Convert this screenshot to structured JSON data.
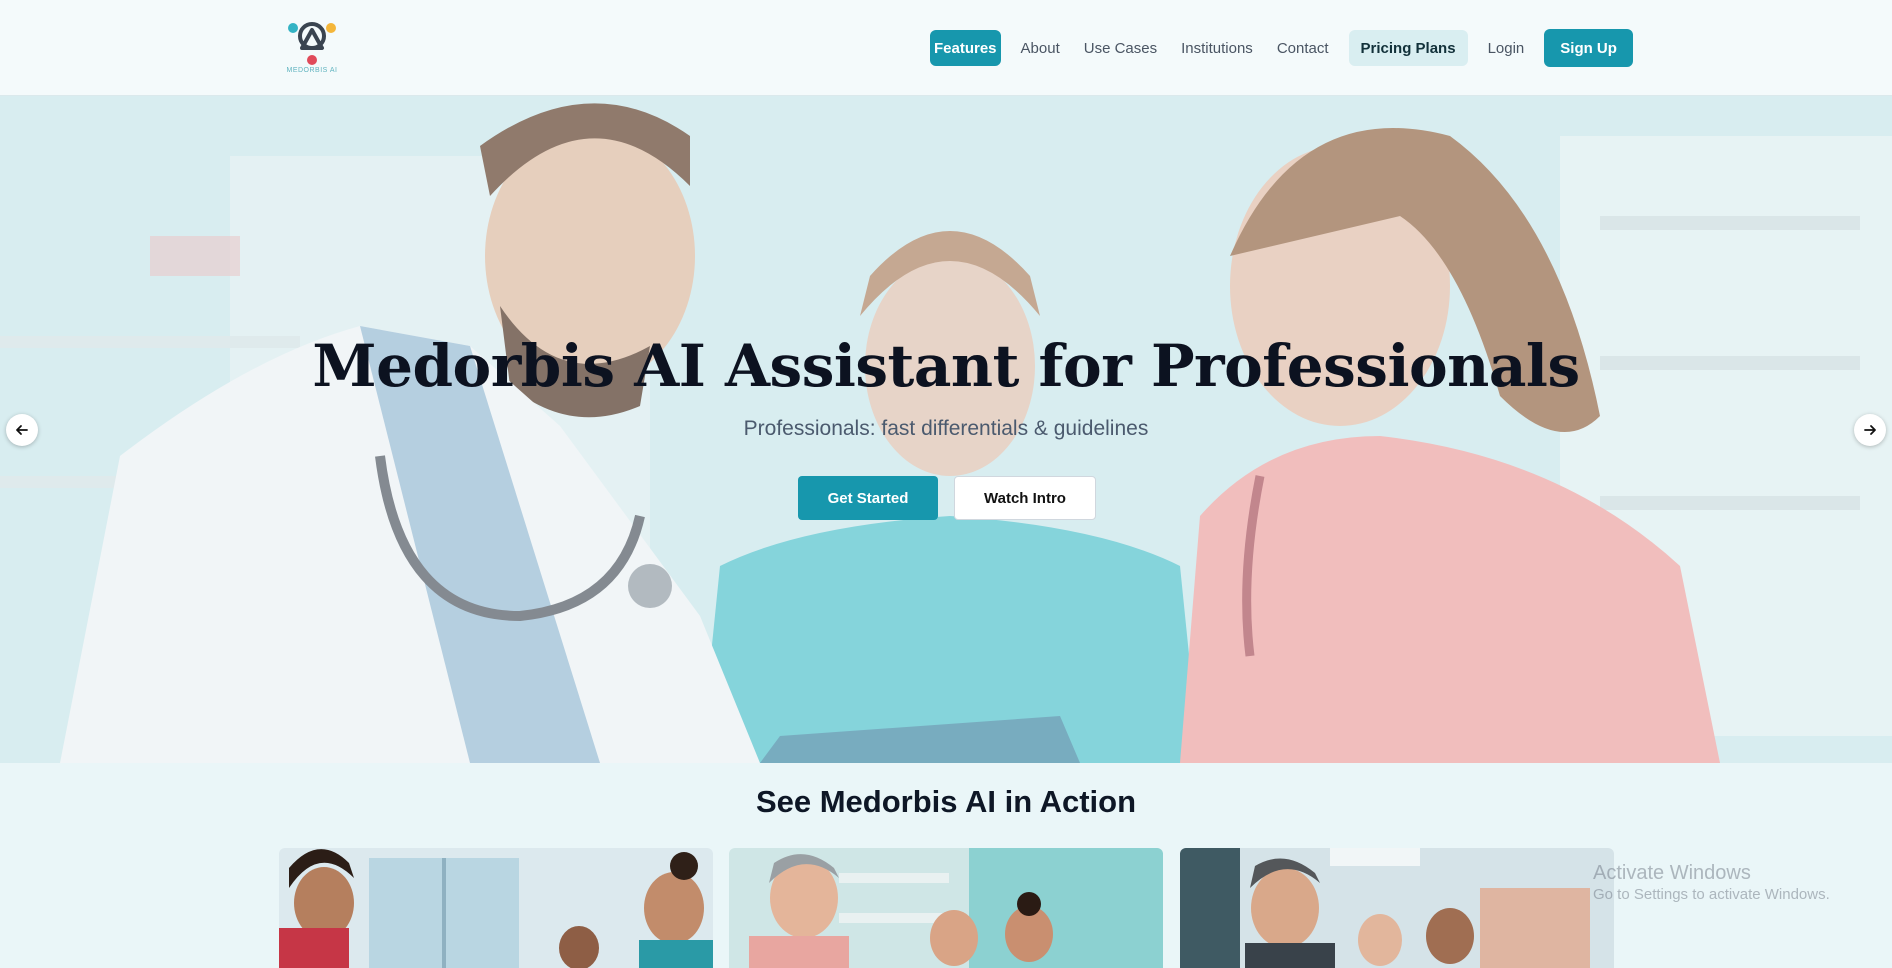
{
  "brand": {
    "logo_text": "MEDORBIS AI",
    "colors": {
      "primary": "#1797ad",
      "logo_dark": "#3a4450",
      "logo_teal": "#34b3c4",
      "logo_yellow": "#f4b63a",
      "logo_red": "#e04a5a"
    }
  },
  "nav": {
    "items": [
      {
        "label": "Features"
      },
      {
        "label": "About"
      },
      {
        "label": "Use Cases"
      },
      {
        "label": "Institutions"
      },
      {
        "label": "Contact"
      },
      {
        "label": "Pricing Plans"
      },
      {
        "label": "Login"
      },
      {
        "label": "Sign Up"
      }
    ]
  },
  "hero": {
    "title": "Medorbis AI Assistant for Professionals",
    "subtitle": "Professionals: fast differentials & guidelines",
    "primary_cta": "Get Started",
    "secondary_cta": "Watch Intro",
    "prev_icon": "arrow-left-icon",
    "next_icon": "arrow-right-icon"
  },
  "action_section": {
    "title": "See Medorbis AI in Action"
  },
  "os_watermark": {
    "line1": "Activate Windows",
    "line2": "Go to Settings to activate Windows."
  }
}
